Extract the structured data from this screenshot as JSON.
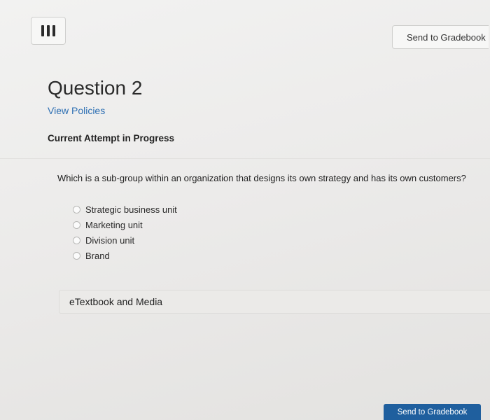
{
  "header": {
    "send_to_gradebook_label": "Send to Gradebook"
  },
  "question": {
    "title": "Question 2",
    "view_policies_label": "View Policies",
    "attempt_status": "Current Attempt in Progress",
    "prompt": "Which is a sub-group within an organization that designs its own strategy and has its own customers?",
    "options": [
      {
        "label": "Strategic business unit",
        "selected": false
      },
      {
        "label": "Marketing unit",
        "selected": false
      },
      {
        "label": "Division unit",
        "selected": false
      },
      {
        "label": "Brand",
        "selected": false
      }
    ]
  },
  "resources": {
    "etextbook_label": "eTextbook and Media"
  },
  "footer": {
    "send_to_gradebook_label": "Send to Gradebook"
  }
}
